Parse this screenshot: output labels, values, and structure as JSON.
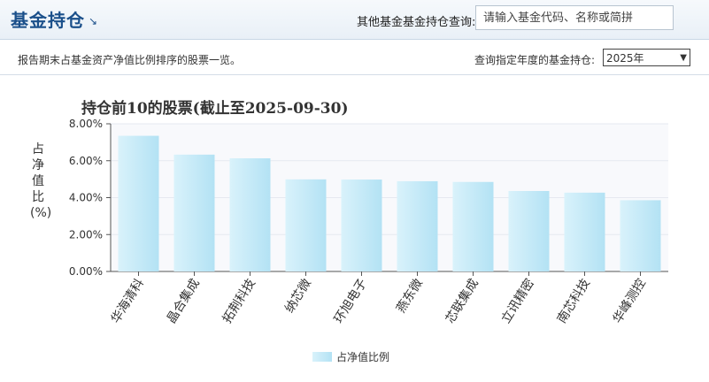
{
  "header": {
    "title": "基金持仓",
    "title_icon": "corner-arrow-icon",
    "search_label": "其他基金基金持仓查询:",
    "search_placeholder": "请输入基金代码、名称或简拼"
  },
  "subheader": {
    "description": "报告期末占基金资产净值比例排序的股票一览。",
    "year_label": "查询指定年度的基金持仓:",
    "year_selected": "2025年"
  },
  "chart_data": {
    "type": "bar",
    "title": "持仓前10的股票(截止至2025-09-30)",
    "ylabel": "占净值比(%)",
    "categories": [
      "华海清科",
      "晶合集成",
      "拓荆科技",
      "纳芯微",
      "环旭电子",
      "燕东微",
      "芯联集成",
      "立讯精密",
      "南芯科技",
      "华峰测控"
    ],
    "series": [
      {
        "name": "占净值比例",
        "values": [
          7.35,
          6.33,
          6.13,
          4.99,
          4.98,
          4.89,
          4.85,
          4.36,
          4.27,
          3.86
        ]
      }
    ],
    "ylim": [
      0,
      8
    ],
    "yticks": [
      "0.00%",
      "2.00%",
      "4.00%",
      "6.00%",
      "8.00%"
    ],
    "bar_color": "#c2e8f6",
    "grid": true,
    "legend_position": "bottom"
  }
}
